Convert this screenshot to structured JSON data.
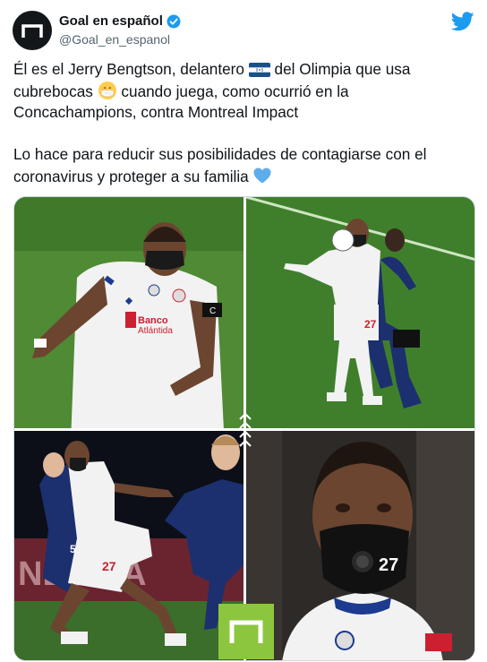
{
  "account": {
    "display_name": "Goal en español",
    "handle": "@Goal_en_espanol",
    "avatar_icon": "goal-logo-icon",
    "verified_icon": "verified-badge-icon"
  },
  "platform_icon": "twitter-bird-icon",
  "tweet": {
    "line1_a": "Él es el Jerry Bengtson, delantero ",
    "line1_flag": "honduras-flag-icon",
    "line1_b": " del Olimpia que usa cubrebocas ",
    "line1_emoji": "mask-face-emoji",
    "line1_c": " cuando juega, como ocurrió en la Concachampions, contra Montreal Impact",
    "line2_a": "Lo hace para reducir sus posibilidades de contagiarse con el coronavirus y proteger a su familia ",
    "line2_emoji": "blue-heart-emoji"
  },
  "media": {
    "photos": [
      {
        "alt_label": "player-masked-closeup"
      },
      {
        "alt_label": "player-heading-ball"
      },
      {
        "alt_label": "player-running-night"
      },
      {
        "alt_label": "player-face-mask-portrait"
      }
    ],
    "jersey_numbers": [
      "27",
      "27",
      "27",
      "5"
    ],
    "sponsor_text": "Banco Atlántida",
    "overlay_logo": "goal-logo-icon",
    "colors": {
      "pitch_green": "#4f8a34",
      "jersey_white": "#f2f2f2",
      "montreal_blue": "#1c2f6e",
      "logo_green": "#8cc63f"
    }
  }
}
